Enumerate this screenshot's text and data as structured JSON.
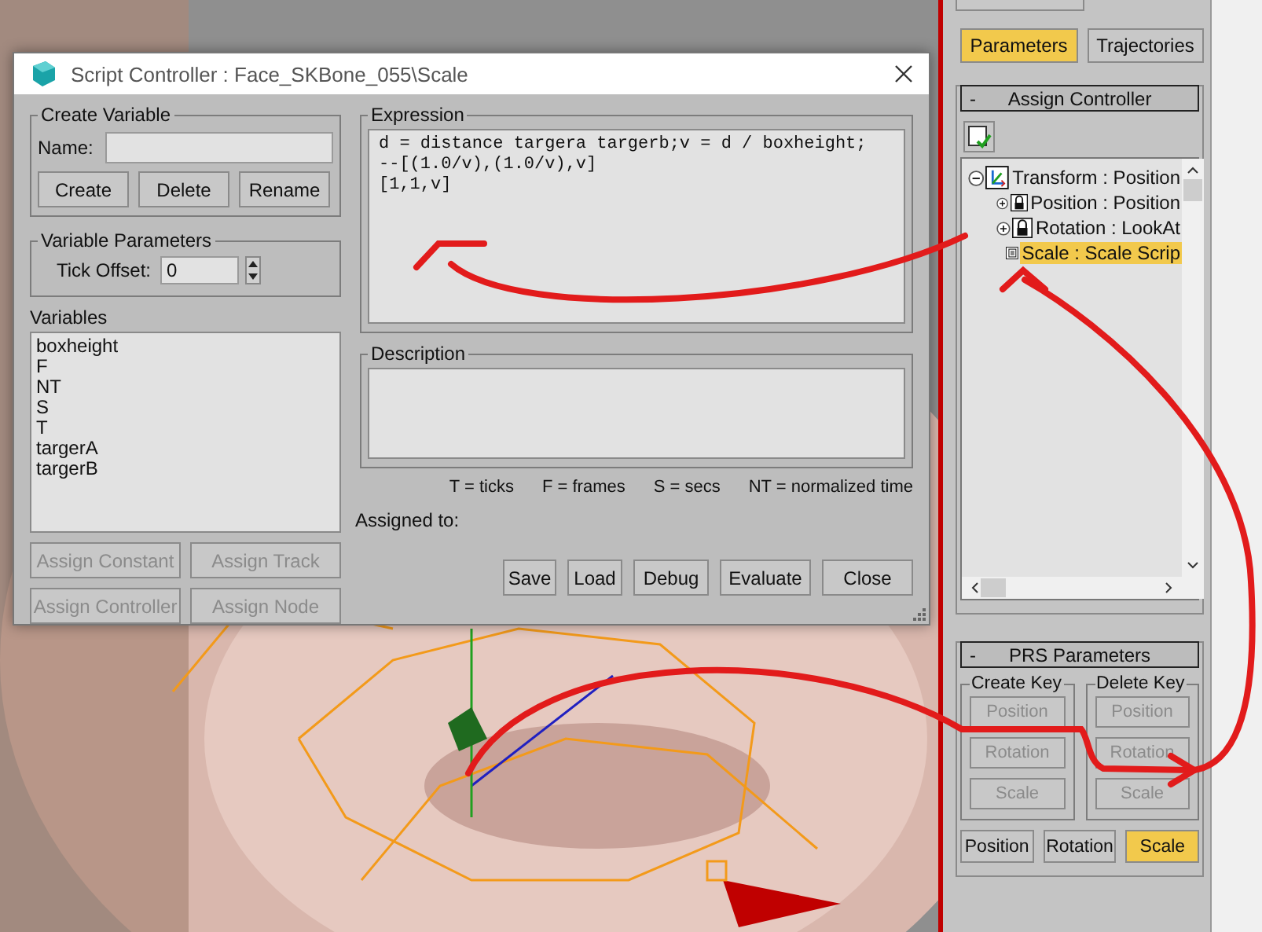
{
  "dialog": {
    "title": "Script Controller : Face_SKBone_055\\Scale",
    "create_variable": {
      "title": "Create Variable",
      "name_label": "Name:",
      "buttons": [
        "Create",
        "Delete",
        "Rename"
      ]
    },
    "variable_parameters": {
      "title": "Variable Parameters",
      "tick_offset_label": "Tick Offset:",
      "tick_offset_value": "0"
    },
    "variables": {
      "title": "Variables",
      "items": [
        "boxheight",
        "F",
        "NT",
        "S",
        "T",
        "targerA",
        "targerB"
      ]
    },
    "assign_buttons": [
      {
        "label": "Assign Constant",
        "disabled": true
      },
      {
        "label": "Assign Track",
        "disabled": true
      },
      {
        "label": "Assign Controller",
        "disabled": true
      },
      {
        "label": "Assign Node",
        "disabled": true
      }
    ],
    "expression": {
      "title": "Expression",
      "lines": [
        "d = distance targera targerb;v = d / boxheight;",
        "--[(1.0/v),(1.0/v),v]",
        "[1,1,v]"
      ]
    },
    "description": {
      "title": "Description"
    },
    "legend": [
      "T = ticks",
      "F = frames",
      "S = secs",
      "NT = normalized time"
    ],
    "assigned_to_label": "Assigned to:",
    "buttons": [
      "Save",
      "Load",
      "Debug",
      "Evaluate",
      "Close"
    ]
  },
  "command_panel": {
    "tabs": [
      {
        "label": "Parameters",
        "selected": true
      },
      {
        "label": "Trajectories",
        "selected": false
      }
    ],
    "assign_controller": {
      "collapse_symbol": "-",
      "title": "Assign Controller",
      "tree": [
        {
          "label": "Transform : Position",
          "kind": "transform",
          "expanded": true,
          "selected": false,
          "children": [
            {
              "label": "Position : Position",
              "kind": "lock",
              "expanded": false,
              "selected": false
            },
            {
              "label": "Rotation : LookAt",
              "kind": "lock",
              "expanded": false,
              "selected": false
            },
            {
              "label": "Scale : Scale Scrip",
              "kind": "script",
              "selected": true
            }
          ]
        }
      ]
    },
    "prs_parameters": {
      "collapse_symbol": "-",
      "title": "PRS Parameters",
      "create_key": {
        "title": "Create Key",
        "buttons": [
          {
            "label": "Position",
            "disabled": true
          },
          {
            "label": "Rotation",
            "disabled": true
          },
          {
            "label": "Scale",
            "disabled": true
          }
        ]
      },
      "delete_key": {
        "title": "Delete Key",
        "buttons": [
          {
            "label": "Position",
            "disabled": true
          },
          {
            "label": "Rotation",
            "disabled": true
          },
          {
            "label": "Scale",
            "disabled": true
          }
        ]
      },
      "mode_buttons": [
        {
          "label": "Position",
          "selected": false
        },
        {
          "label": "Rotation",
          "selected": false
        },
        {
          "label": "Scale",
          "selected": true
        }
      ]
    }
  }
}
